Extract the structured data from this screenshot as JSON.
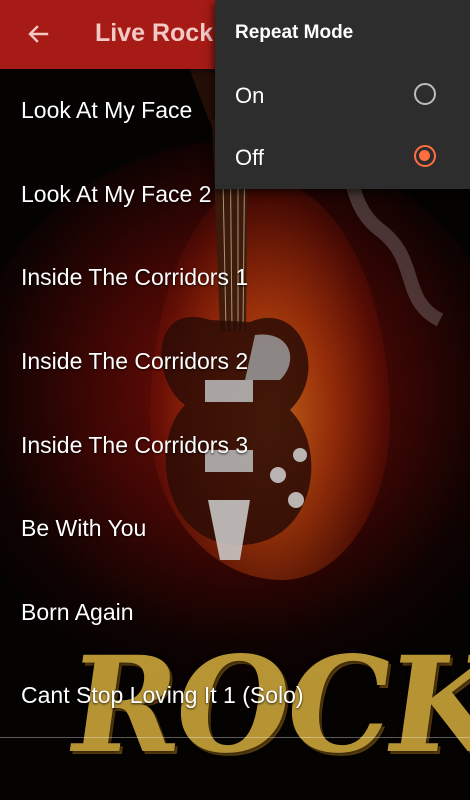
{
  "appbar": {
    "title": "Live Rock",
    "back_icon": "arrow-left-icon",
    "background_color": "#a61b16"
  },
  "songs": [
    "Look At My Face",
    "Look At My Face 2",
    "Inside The Corridors 1",
    "Inside The Corridors 2",
    "Inside The Corridors 3",
    "Be With You",
    "Born Again",
    "Cant Stop Loving It 1 (Solo)"
  ],
  "menu": {
    "title": "Repeat Mode",
    "options": [
      {
        "label": "On",
        "selected": false
      },
      {
        "label": "Off",
        "selected": true
      }
    ],
    "accent_color": "#ff6d40",
    "background_color": "#2d2d2d"
  },
  "background": {
    "artwork_text": "ROCK"
  }
}
